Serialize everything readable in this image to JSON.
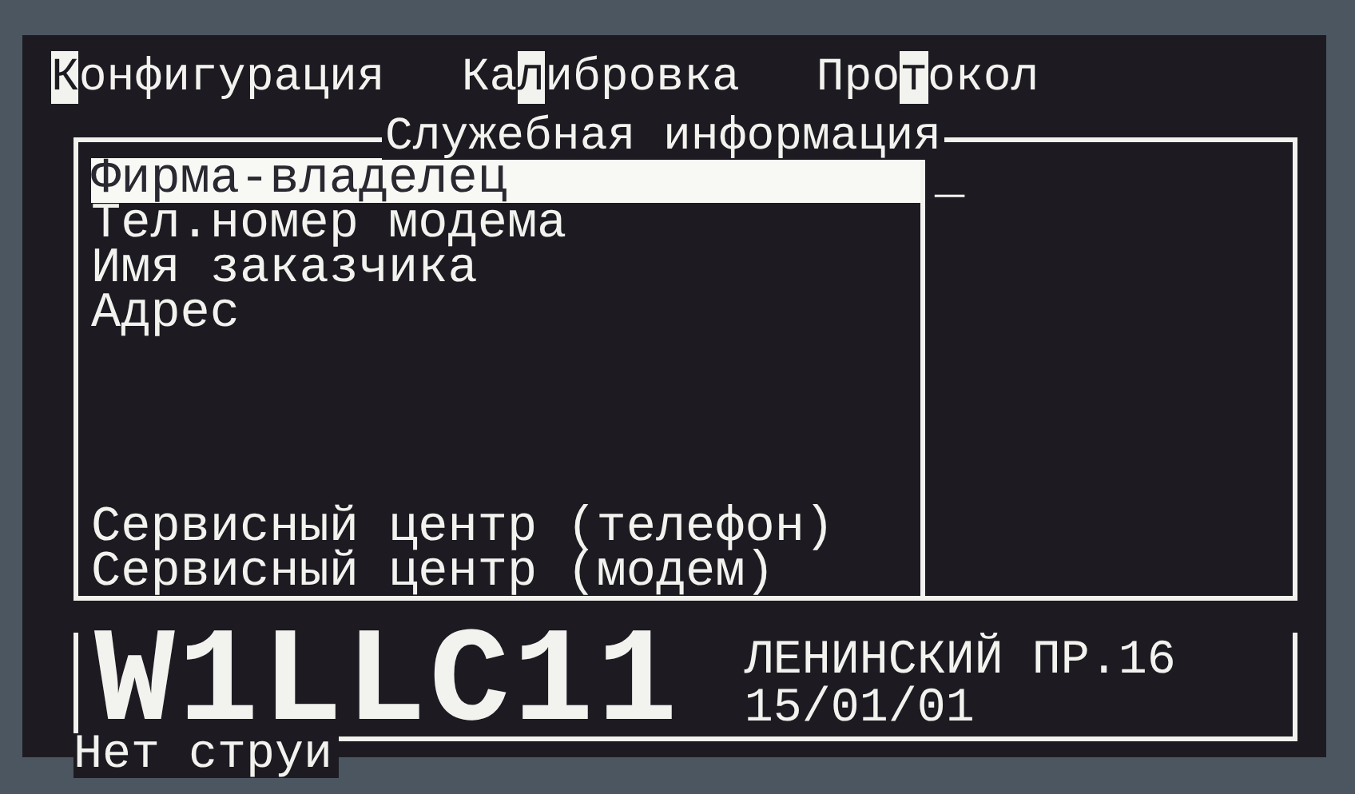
{
  "menu": [
    {
      "key": "К",
      "post": "онфигурация"
    },
    {
      "pre": "Ка",
      "key": "л",
      "post": "ибровка"
    },
    {
      "pre": "Про",
      "key": "т",
      "post": "окол"
    }
  ],
  "panel": {
    "title": "Служебная информация",
    "items": [
      {
        "label": "Фирма-владелец",
        "selected": true
      },
      {
        "label": "Тел.номер модема",
        "selected": false
      },
      {
        "label": "Имя заказчика",
        "selected": false
      },
      {
        "label": "Адрес",
        "selected": false
      }
    ],
    "service_items": [
      {
        "label": "Сервисный центр (телефон)",
        "selected": false
      },
      {
        "label": "Сервисный центр (модем)",
        "selected": false
      }
    ],
    "value": "_"
  },
  "footer": {
    "model": "W1LLC11",
    "address": "ЛЕНИНСКИЙ ПР.16",
    "date": "15/01/01",
    "status": "Нет струи"
  }
}
